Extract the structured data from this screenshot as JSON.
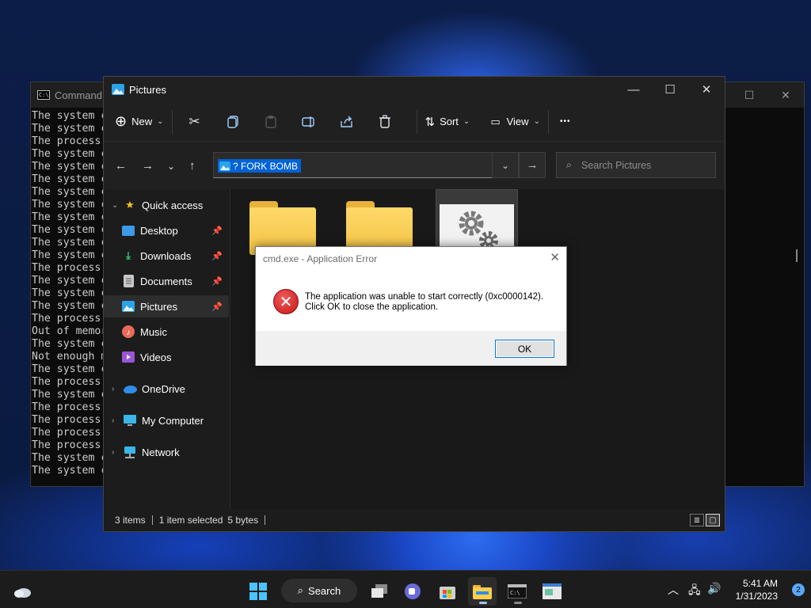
{
  "cmd": {
    "title": "Command Prompt",
    "lines": [
      "The system c",
      "The system c",
      "The process",
      "The system c",
      "The system c",
      "The system c",
      "The system c",
      "The system c",
      "The system c",
      "The system c",
      "The system c",
      "The system c",
      "The process",
      "The system c",
      "The system c",
      "The system c",
      "The process",
      "Out of memor",
      "The system c",
      "Not enough m",
      "The system c",
      "The process",
      "The system c",
      "The process",
      "The process",
      "The process",
      "The process",
      "The system c",
      "The system c"
    ]
  },
  "explorer": {
    "title": "Pictures",
    "toolbar": {
      "new_label": "New",
      "sort_label": "Sort",
      "view_label": "View",
      "more_label": "•••"
    },
    "address": {
      "path": "? FORK BOMB"
    },
    "search": {
      "placeholder": "Search Pictures"
    },
    "nav": {
      "quick_access": "Quick access",
      "desktop": "Desktop",
      "downloads": "Downloads",
      "documents": "Documents",
      "pictures": "Pictures",
      "music": "Music",
      "videos": "Videos",
      "onedrive": "OneDrive",
      "my_computer": "My Computer",
      "network": "Network"
    },
    "status": {
      "items": "3 items",
      "selected": "1 item selected",
      "size": "5 bytes"
    }
  },
  "dialog": {
    "title": "cmd.exe - Application Error",
    "message_line1": "The application was unable to start correctly (0xc0000142).",
    "message_line2": "Click OK to close the application.",
    "ok_label": "OK"
  },
  "taskbar": {
    "search_label": "Search",
    "time": "5:41 AM",
    "date": "1/31/2023",
    "notification_count": "2"
  },
  "colors": {
    "accent": "#0063d6",
    "folder": "#f3c445",
    "error_red": "#c31818"
  }
}
